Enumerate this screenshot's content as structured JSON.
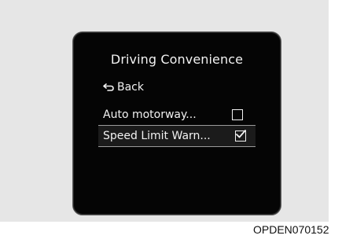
{
  "screen": {
    "title": "Driving Convenience",
    "back_label": "Back",
    "items": [
      {
        "label": "Auto motorway...",
        "checked": false
      },
      {
        "label": "Speed Limit Warn...",
        "checked": true
      }
    ]
  },
  "caption": "OPDEN070152",
  "colors": {
    "screen_background": "#050505",
    "text": "#f2f2f2",
    "selection_background": "#1b1b1b",
    "panel": "#e6e6e6"
  },
  "icons": {
    "back": "back-arrow-icon",
    "unchecked": "checkbox-icon",
    "checked": "checkbox-checked-icon"
  }
}
